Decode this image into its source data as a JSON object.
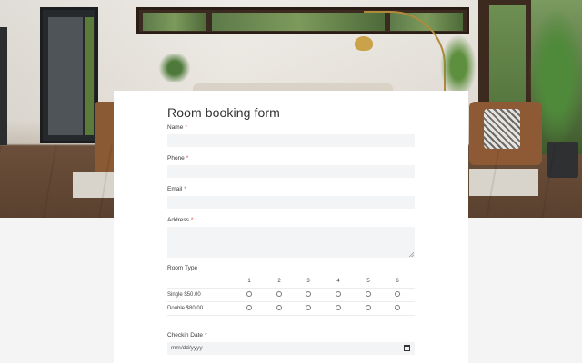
{
  "form": {
    "title": "Room booking form",
    "required_mark": "*",
    "fields": {
      "name_label": "Name",
      "phone_label": "Phone",
      "email_label": "Email",
      "address_label": "Address",
      "room_type_label": "Room Type",
      "checkin_label": "Checkin Date",
      "checkin_placeholder": "mm/dd/yyyy"
    },
    "room_type_grid": {
      "columns": [
        "1",
        "2",
        "3",
        "4",
        "5",
        "6"
      ],
      "rows": [
        "Single $50.00",
        "Double $80.00"
      ]
    }
  },
  "icons": {
    "calendar": "calendar-icon",
    "resize": "resize-handle-icon"
  },
  "colors": {
    "required": "#e04a4a",
    "field_bg": "#f3f4f6",
    "page_bg": "#f4f4f4"
  }
}
